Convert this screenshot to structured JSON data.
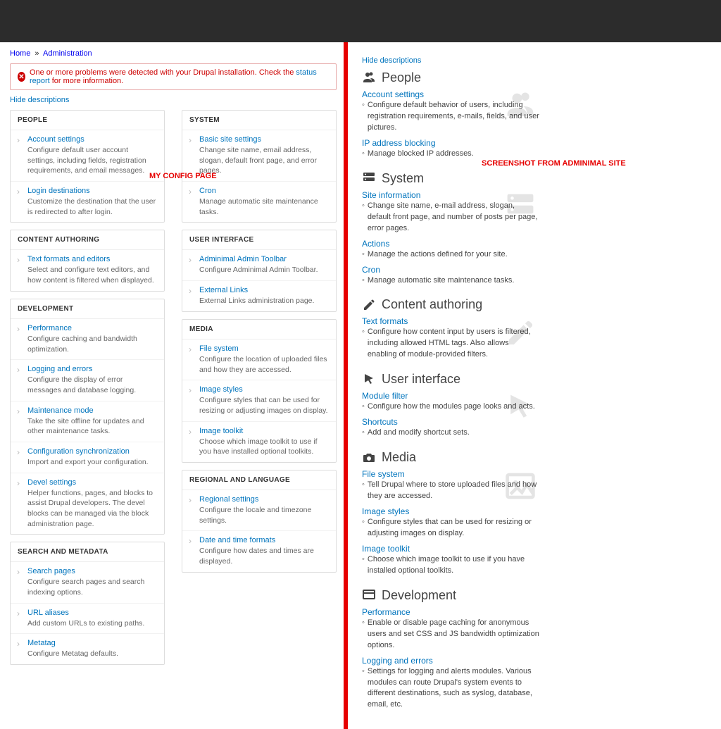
{
  "breadcrumb": {
    "home": "Home",
    "admin": "Administration"
  },
  "alert": {
    "pre": "One or more problems were detected with your Drupal installation. Check the ",
    "link": "status report",
    "post": " for more information."
  },
  "hide_desc": "Hide descriptions",
  "overlay_left": "MY CONFIG PAGE",
  "overlay_right": "SCREENSHOT FROM ADMINIMAL SITE",
  "left": {
    "col1": [
      {
        "h": "PEOPLE",
        "items": [
          {
            "t": "Account settings",
            "d": "Configure default user account settings, including fields, registration requirements, and email messages."
          },
          {
            "t": "Login destinations",
            "d": "Customize the destination that the user is redirected to after login."
          }
        ]
      },
      {
        "h": "CONTENT AUTHORING",
        "items": [
          {
            "t": "Text formats and editors",
            "d": "Select and configure text editors, and how content is filtered when displayed."
          }
        ]
      },
      {
        "h": "DEVELOPMENT",
        "items": [
          {
            "t": "Performance",
            "d": "Configure caching and bandwidth optimization."
          },
          {
            "t": "Logging and errors",
            "d": "Configure the display of error messages and database logging."
          },
          {
            "t": "Maintenance mode",
            "d": "Take the site offline for updates and other maintenance tasks."
          },
          {
            "t": "Configuration synchronization",
            "d": "Import and export your configuration."
          },
          {
            "t": "Devel settings",
            "d": "Helper functions, pages, and blocks to assist Drupal developers. The devel blocks can be managed via the block administration page."
          }
        ]
      },
      {
        "h": "SEARCH AND METADATA",
        "items": [
          {
            "t": "Search pages",
            "d": "Configure search pages and search indexing options."
          },
          {
            "t": "URL aliases",
            "d": "Add custom URLs to existing paths."
          },
          {
            "t": "Metatag",
            "d": "Configure Metatag defaults."
          }
        ]
      }
    ],
    "col2": [
      {
        "h": "SYSTEM",
        "items": [
          {
            "t": "Basic site settings",
            "d": "Change site name, email address, slogan, default front page, and error pages."
          },
          {
            "t": "Cron",
            "d": "Manage automatic site maintenance tasks."
          }
        ]
      },
      {
        "h": "USER INTERFACE",
        "items": [
          {
            "t": "Adminimal Admin Toolbar",
            "d": "Configure Adminimal Admin Toolbar."
          },
          {
            "t": "External Links",
            "d": "External Links administration page."
          }
        ]
      },
      {
        "h": "MEDIA",
        "items": [
          {
            "t": "File system",
            "d": "Configure the location of uploaded files and how they are accessed."
          },
          {
            "t": "Image styles",
            "d": "Configure styles that can be used for resizing or adjusting images on display."
          },
          {
            "t": "Image toolkit",
            "d": "Choose which image toolkit to use if you have installed optional toolkits."
          }
        ]
      },
      {
        "h": "REGIONAL AND LANGUAGE",
        "items": [
          {
            "t": "Regional settings",
            "d": "Configure the locale and timezone settings."
          },
          {
            "t": "Date and time formats",
            "d": "Configure how dates and times are displayed."
          }
        ]
      }
    ]
  },
  "right": [
    {
      "title": "People",
      "icon": "users",
      "bg": "users",
      "items": [
        {
          "t": "Account settings",
          "d": "Configure default behavior of users, including registration requirements, e-mails, fields, and user pictures."
        },
        {
          "t": "IP address blocking",
          "d": "Manage blocked IP addresses."
        }
      ]
    },
    {
      "title": "System",
      "icon": "server",
      "bg": "server",
      "items": [
        {
          "t": "Site information",
          "d": "Change site name, e-mail address, slogan, default front page, and number of posts per page, error pages."
        },
        {
          "t": "Actions",
          "d": "Manage the actions defined for your site."
        },
        {
          "t": "Cron",
          "d": "Manage automatic site maintenance tasks."
        }
      ]
    },
    {
      "title": "Content authoring",
      "icon": "pencil",
      "bg": "pencil",
      "items": [
        {
          "t": "Text formats",
          "d": "Configure how content input by users is filtered, including allowed HTML tags. Also allows enabling of module-provided filters."
        }
      ]
    },
    {
      "title": "User interface",
      "icon": "pointer",
      "bg": "pointer",
      "items": [
        {
          "t": "Module filter",
          "d": "Configure how the modules page looks and acts."
        },
        {
          "t": "Shortcuts",
          "d": "Add and modify shortcut sets."
        }
      ]
    },
    {
      "title": "Media",
      "icon": "camera",
      "bg": "image",
      "items": [
        {
          "t": "File system",
          "d": "Tell Drupal where to store uploaded files and how they are accessed."
        },
        {
          "t": "Image styles",
          "d": "Configure styles that can be used for resizing or adjusting images on display."
        },
        {
          "t": "Image toolkit",
          "d": "Choose which image toolkit to use if you have installed optional toolkits."
        }
      ]
    },
    {
      "title": "Development",
      "icon": "window",
      "bg": "",
      "items": [
        {
          "t": "Performance",
          "d": "Enable or disable page caching for anonymous users and set CSS and JS bandwidth optimization options."
        },
        {
          "t": "Logging and errors",
          "d": "Settings for logging and alerts modules. Various modules can route Drupal's system events to different destinations, such as syslog, database, email, etc."
        }
      ]
    }
  ]
}
